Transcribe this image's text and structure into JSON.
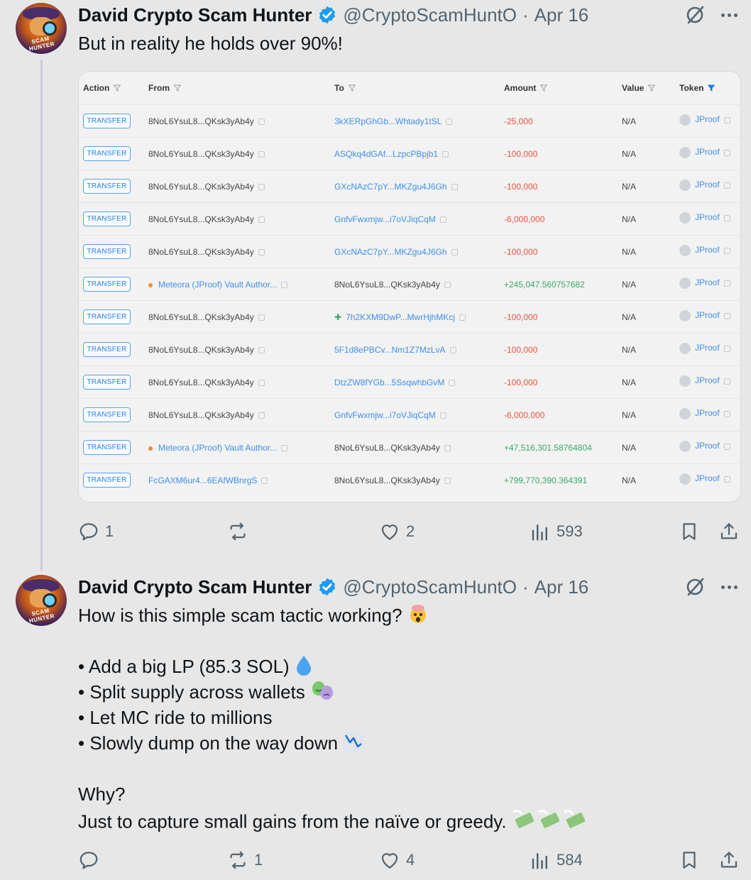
{
  "tweets": [
    {
      "author": "David Crypto Scam Hunter",
      "handle": "@CryptoScamHuntO",
      "dot": "·",
      "date": "Apr 16",
      "avatar_text": "SCAM HUNTER",
      "text": "But in reality he holds over 90%!",
      "stats": {
        "replies": "1",
        "reposts": "",
        "likes": "2",
        "views": "593"
      }
    },
    {
      "author": "David Crypto Scam Hunter",
      "handle": "@CryptoScamHuntO",
      "dot": "·",
      "date": "Apr 16",
      "avatar_text": "SCAM HUNTER",
      "lines": [
        "How is this simple scam tactic working?",
        "",
        "• Add a big LP (85.3 SOL)",
        "• Split supply across wallets",
        "• Let MC ride to millions",
        "• Slowly dump on the way down",
        "",
        "Why?",
        "Just to capture small gains from the naïve or greedy."
      ],
      "stats": {
        "replies": "",
        "reposts": "1",
        "likes": "4",
        "views": "584"
      }
    }
  ],
  "table": {
    "headers": {
      "action": "Action",
      "from": "From",
      "to": "To",
      "amount": "Amount",
      "value": "Value",
      "token": "Token"
    },
    "rows": [
      {
        "action": "TRANSFER",
        "from": "8NoL6YsuL8...QKsk3yAb4y",
        "to": "3kXERpGhGb...Whtady1tSL",
        "amount": "-25,000",
        "value": "N/A",
        "token": "JProof"
      },
      {
        "action": "TRANSFER",
        "from": "8NoL6YsuL8...QKsk3yAb4y",
        "to": "ASQkq4dGAf...LzpcPBpjb1",
        "amount": "-100,000",
        "value": "N/A",
        "token": "JProof"
      },
      {
        "action": "TRANSFER",
        "from": "8NoL6YsuL8...QKsk3yAb4y",
        "to": "GXcNAzC7pY...MKZgu4J6Gh",
        "amount": "-100,000",
        "value": "N/A",
        "token": "JProof"
      },
      {
        "action": "TRANSFER",
        "from": "8NoL6YsuL8...QKsk3yAb4y",
        "to": "GnfvFwxmjw...i7oVJiqCqM",
        "amount": "-6,000,000",
        "value": "N/A",
        "token": "JProof"
      },
      {
        "action": "TRANSFER",
        "from": "8NoL6YsuL8...QKsk3yAb4y",
        "to": "GXcNAzC7pY...MKZgu4J6Gh",
        "amount": "-100,000",
        "value": "N/A",
        "token": "JProof"
      },
      {
        "action": "TRANSFER",
        "from": "Meteora (JProof) Vault Author...",
        "to": "8NoL6YsuL8...QKsk3yAb4y",
        "amount": "+245,047.560757682",
        "value": "N/A",
        "token": "JProof"
      },
      {
        "action": "TRANSFER",
        "from": "8NoL6YsuL8...QKsk3yAb4y",
        "to": "7h2KXM9DwP...MwrHjhMKcj",
        "amount": "-100,000",
        "value": "N/A",
        "token": "JProof"
      },
      {
        "action": "TRANSFER",
        "from": "8NoL6YsuL8...QKsk3yAb4y",
        "to": "5F1d8ePBCv...Nm1Z7MzLvA",
        "amount": "-100,000",
        "value": "N/A",
        "token": "JProof"
      },
      {
        "action": "TRANSFER",
        "from": "8NoL6YsuL8...QKsk3yAb4y",
        "to": "DtzZW8fYGb...5SsqwhbGvM",
        "amount": "-100,000",
        "value": "N/A",
        "token": "JProof"
      },
      {
        "action": "TRANSFER",
        "from": "8NoL6YsuL8...QKsk3yAb4y",
        "to": "GnfvFwxmjw...i7oVJiqCqM",
        "amount": "-6,000,000",
        "value": "N/A",
        "token": "JProof"
      },
      {
        "action": "TRANSFER",
        "from": "Meteora (JProof) Vault Author...",
        "to": "8NoL6YsuL8...QKsk3yAb4y",
        "amount": "+47,516,301.58764804",
        "value": "N/A",
        "token": "JProof"
      },
      {
        "action": "TRANSFER",
        "from": "FcGAXM6ur4...6EAfWBnrgS",
        "to": "8NoL6YsuL8...QKsk3yAb4y",
        "amount": "+799,770,390.364391",
        "value": "N/A",
        "token": "JProof"
      }
    ]
  },
  "colors": {
    "accent": "#1d9bf0",
    "link": "#3d8fe8",
    "negative": "#e5533d",
    "positive": "#3aa86b",
    "muted": "#536471"
  },
  "icons": [
    "verified-badge-icon",
    "grok-icon",
    "more-icon",
    "reply-icon",
    "repost-icon",
    "like-icon",
    "views-icon",
    "bookmark-icon",
    "share-icon",
    "filter-icon",
    "copy-icon",
    "token-icon"
  ]
}
